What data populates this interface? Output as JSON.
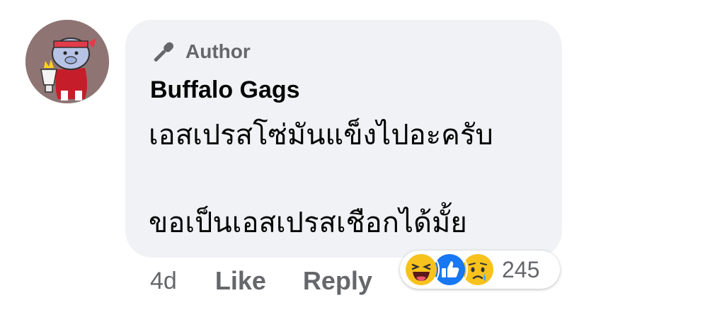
{
  "comment": {
    "badge_label": "Author",
    "author_name": "Buffalo Gags",
    "lines": [
      "เอสเปรสโซ่มันแข็งไปอะครับ",
      "ขอเป็นเอสเปรสเชือกได้มั้ย"
    ],
    "timestamp": "4d",
    "like_label": "Like",
    "reply_label": "Reply",
    "reaction_count": "245",
    "reactions": [
      "haha-icon",
      "like-icon",
      "sad-icon"
    ]
  },
  "colors": {
    "bubble": "#f0f2f5",
    "text": "#050505",
    "secondary": "#65676b",
    "like_blue": "#1877f2",
    "emoji_yellow": "#f7c21e"
  }
}
